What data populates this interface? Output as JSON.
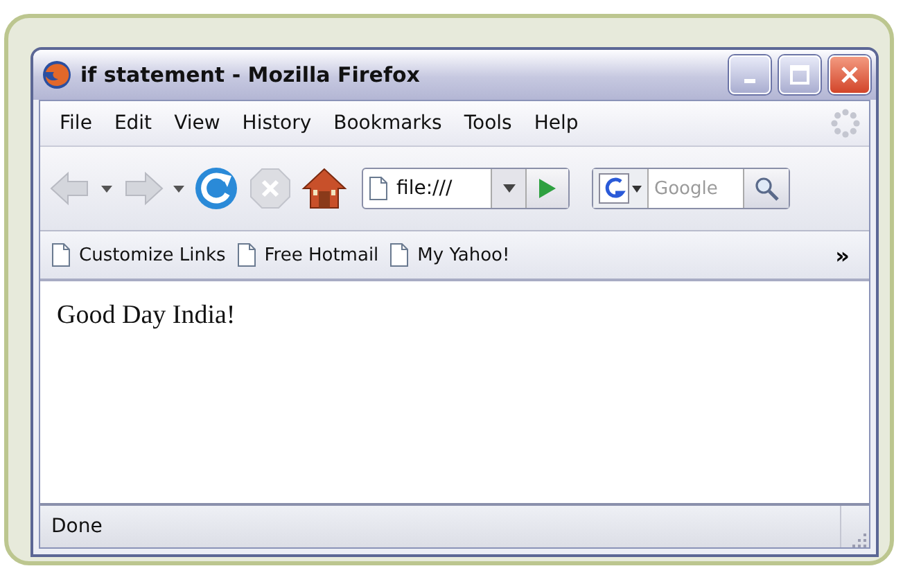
{
  "window": {
    "title": "if statement - Mozilla Firefox"
  },
  "menu": [
    "File",
    "Edit",
    "View",
    "History",
    "Bookmarks",
    "Tools",
    "Help"
  ],
  "toolbar": {
    "buttons": [
      {
        "kind": "back",
        "disabled": true
      },
      {
        "kind": "forward",
        "disabled": true
      },
      {
        "kind": "reload",
        "disabled": false
      },
      {
        "kind": "stop",
        "disabled": true
      },
      {
        "kind": "home",
        "disabled": false
      }
    ],
    "address": {
      "value": "file:///"
    },
    "search": {
      "placeholder": "Google"
    }
  },
  "bookmarks": [
    "Customize Links",
    "Free Hotmail",
    "My Yahoo!"
  ],
  "bookmarks_overflow": "»",
  "content": {
    "text": "Good Day India!"
  },
  "status_bar": {
    "text": "Done"
  }
}
